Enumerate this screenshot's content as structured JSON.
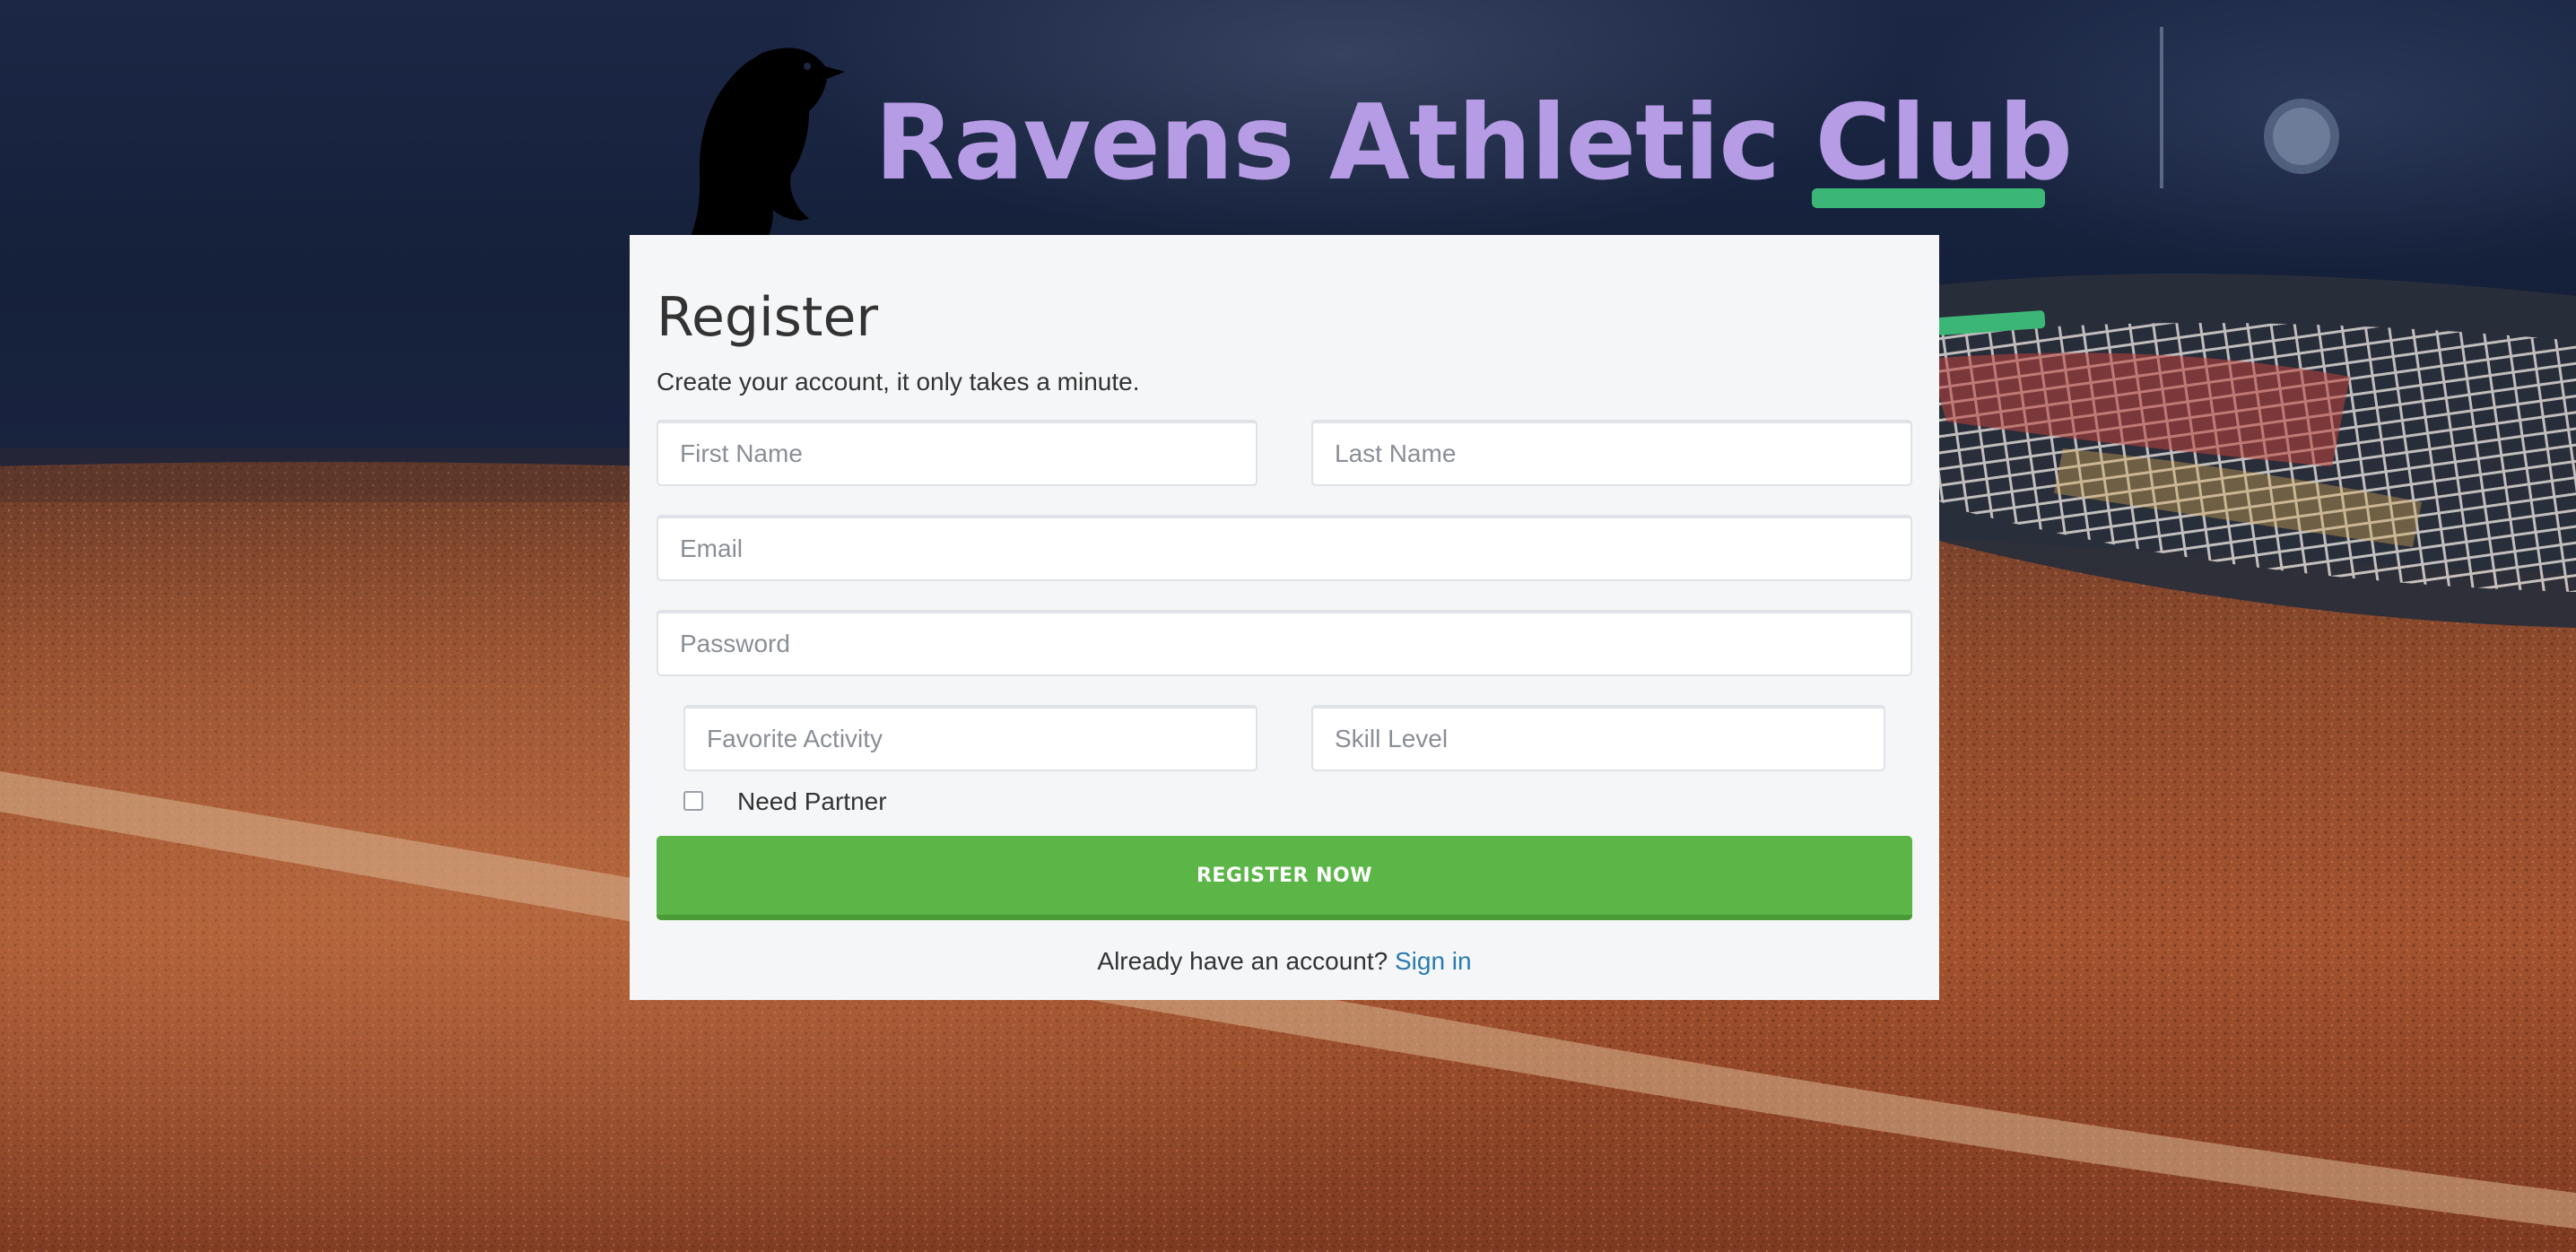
{
  "site": {
    "title": "Ravens Athletic Club",
    "logo_icon": "raven-icon",
    "title_color": "#b59ce4"
  },
  "background": {
    "description_icon": "tennis-court-photo",
    "court_color": "#a8532f",
    "sky_color": "#1b2745"
  },
  "form": {
    "title": "Register",
    "subtitle": "Create your account, it only takes a minute.",
    "fields": {
      "first_name": {
        "placeholder": "First Name",
        "value": ""
      },
      "last_name": {
        "placeholder": "Last Name",
        "value": ""
      },
      "email": {
        "placeholder": "Email",
        "value": ""
      },
      "password": {
        "placeholder": "Password",
        "value": ""
      },
      "favorite_activity": {
        "placeholder": "Favorite Activity",
        "value": ""
      },
      "skill_level": {
        "placeholder": "Skill Level",
        "value": ""
      }
    },
    "need_partner": {
      "label": "Need Partner",
      "checked": false
    },
    "submit_label": "Register Now",
    "submit_color": "#5bb547",
    "signin_prompt": "Already have an account?",
    "signin_link": "Sign in",
    "link_color": "#2a7ab0"
  }
}
